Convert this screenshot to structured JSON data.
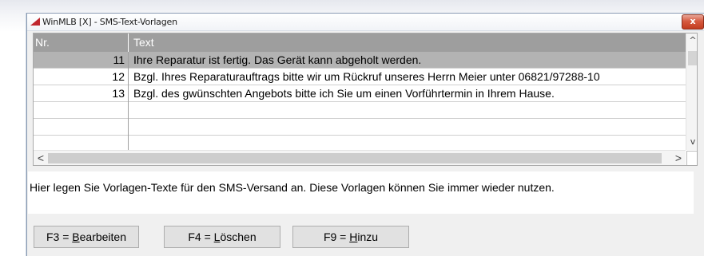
{
  "window": {
    "title": "WinMLB [X] - SMS-Text-Vorlagen",
    "close_label": "x"
  },
  "grid": {
    "columns": [
      "Nr.",
      "Text"
    ],
    "rows": [
      {
        "nr": "11",
        "text": "Ihre Reparatur ist fertig. Das Gerät kann abgeholt werden.",
        "selected": true
      },
      {
        "nr": "12",
        "text": "Bzgl. Ihres Reparaturauftrags bitte wir um Rückruf unseres Herrn Meier unter 06821/97288-10",
        "selected": false
      },
      {
        "nr": "13",
        "text": "Bzgl. des gwünschten Angebots bitte ich Sie um einen Vorführtermin in Ihrem Hause.",
        "selected": false
      }
    ],
    "scroll_up": "^",
    "scroll_down": "v",
    "scroll_left": "<",
    "scroll_right": ">"
  },
  "info": {
    "text": "Hier legen Sie Vorlagen-Texte für den SMS-Versand an. Diese Vorlagen können Sie immer wieder nutzen."
  },
  "buttons": {
    "edit": {
      "prefix": "F3 = ",
      "hotkey": "B",
      "rest": "earbeiten"
    },
    "delete": {
      "prefix": "F4 = ",
      "hotkey": "L",
      "rest": "öschen"
    },
    "add": {
      "prefix": "F9 = ",
      "hotkey": "H",
      "rest": "inzu"
    }
  },
  "colors": {
    "header_bg": "#9e9e9e",
    "selected_row_bg": "#b3b3b3",
    "close_button": "#c23c1f",
    "title_icon": "#c0262d"
  }
}
